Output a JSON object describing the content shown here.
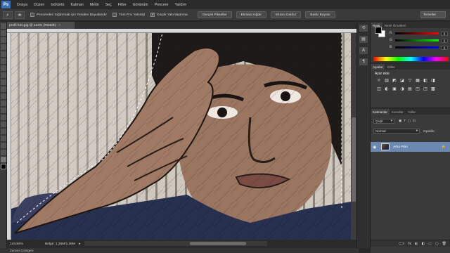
{
  "app": {
    "logo": "Ps"
  },
  "menu": [
    "Dosya",
    "Düzen",
    "Görüntü",
    "Katman",
    "Metin",
    "Seç",
    "Filtre",
    "Görünüm",
    "Pencere",
    "Yardım"
  ],
  "options_bar": {
    "tool_icon": "zoom-icon",
    "check_resize": {
      "label": "Pencereleri Sığdırmak için Yeniden Boyutlandır",
      "checked": false
    },
    "check_all": {
      "label": "Tüm Pnc Yakınlşt",
      "checked": false
    },
    "check_scrubby": {
      "label": "Küçük Yakınlaştırma",
      "checked": true
    },
    "btn_actual": "Gerçek Pikseller",
    "btn_fit": "Ekrana Sığdır",
    "btn_fill": "Ekranı Doldur",
    "btn_print": "Baskı Boyutu",
    "workspace": "Temeller"
  },
  "document": {
    "tab_title": "profil foto.jpg @ 144% (RGB/8)",
    "close": "×"
  },
  "status": {
    "zoom": "143,84%",
    "doc_size": "Belge: 1,36M/1,36M",
    "arrow": "▸"
  },
  "timeline": {
    "label": "Zaman Çizelgesi"
  },
  "color_panel": {
    "tabs": [
      "Renk",
      "Renk Örnekleri"
    ],
    "sliders": [
      {
        "label": "R",
        "value": "0",
        "color": "#cc0000"
      },
      {
        "label": "G",
        "value": "0",
        "color": "#00aa00"
      },
      {
        "label": "B",
        "value": "0",
        "color": "#0044cc"
      }
    ]
  },
  "adjust_panel": {
    "tabs": [
      "Ayarlar",
      "Stiller"
    ],
    "title": "Ayar ekle",
    "icons": [
      "☼",
      "▥",
      "◩",
      "◪",
      "▽",
      "▦",
      "◧",
      "◨",
      "◫",
      "◐",
      "▣",
      "◑",
      "▤",
      "◰",
      "◳",
      "▩"
    ]
  },
  "layers_panel": {
    "tabs": [
      "Katmanlar",
      "Kanallar",
      "Yollar"
    ],
    "filter": "Çeşit",
    "blend_mode": "Normal",
    "opacity_label": "Opaklık:",
    "layer": {
      "name": "Arka Plan",
      "eye": "◉",
      "lock": "🔒"
    },
    "footer": [
      "⊂⊃",
      "fx",
      "◐",
      "◧",
      "▭",
      "▢",
      "🗑"
    ]
  }
}
